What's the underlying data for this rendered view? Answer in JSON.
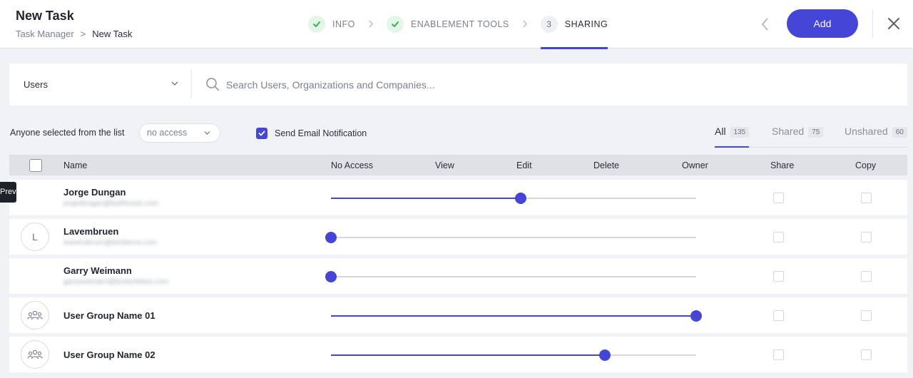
{
  "header": {
    "title": "New Task",
    "breadcrumb": [
      "Task Manager",
      "New Task"
    ],
    "breadcrumb_sep": ">",
    "steps": [
      {
        "label": "INFO",
        "state": "done"
      },
      {
        "label": "ENABLEMENT TOOLS",
        "state": "done"
      },
      {
        "label": "SHARING",
        "state": "active",
        "number": "3"
      }
    ],
    "add_label": "Add"
  },
  "search": {
    "type_value": "Users",
    "placeholder": "Search Users, Organizations and Companies..."
  },
  "filters": {
    "anyone_label": "Anyone selected from the list",
    "access_value": "no access",
    "notify_label": "Send Email Notification",
    "notify_checked": true,
    "tabs": [
      {
        "label": "All",
        "count": "135",
        "active": true
      },
      {
        "label": "Shared",
        "count": "75",
        "active": false
      },
      {
        "label": "Unshared",
        "count": "60",
        "active": false
      }
    ]
  },
  "table": {
    "columns": [
      "Name",
      "No Access",
      "View",
      "Edit",
      "Delete",
      "Owner",
      "Share",
      "Copy"
    ],
    "permission_levels": [
      "No Access",
      "View",
      "Edit",
      "Delete",
      "Owner"
    ],
    "rows": [
      {
        "name": "Jorge Dungan",
        "email": "jorgedungan@bodhiuzas.com",
        "avatar": "",
        "level": 0.52,
        "share": false,
        "copy": false
      },
      {
        "name": "Lavembruen",
        "email": "leavembruen@lemberns.com",
        "avatar": "L",
        "level": 0.0,
        "share": false,
        "copy": false
      },
      {
        "name": "Garry Weimann",
        "email": "garryweimann@borfonfeboo.com",
        "avatar": "",
        "level": 0.0,
        "share": false,
        "copy": false
      },
      {
        "name": "User Group Name 01",
        "email": "",
        "avatar": "group-icon",
        "level": 1.0,
        "share": false,
        "copy": false
      },
      {
        "name": "User Group Name 02",
        "email": "",
        "avatar": "group-icon",
        "level": 0.75,
        "share": false,
        "copy": false
      }
    ]
  },
  "tooltip": "Previous",
  "colors": {
    "accent": "#4545d6",
    "success": "#2fb356"
  }
}
